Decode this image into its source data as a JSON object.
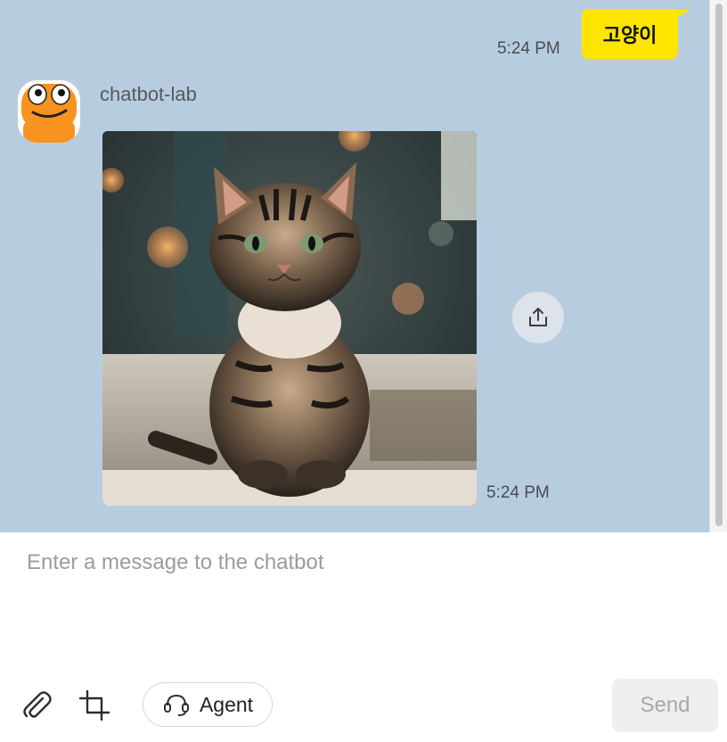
{
  "conversation": {
    "user_message": {
      "text": "고양이",
      "time": "5:24 PM",
      "bubble_color": "#fde500"
    },
    "bot_message": {
      "sender": "chatbot-lab",
      "time": "5:24 PM",
      "image": "photo of a tabby kitten sitting on a blanket with blurred bokeh lights",
      "share_icon": "share-icon"
    },
    "background_color": "#b8cce0"
  },
  "composer": {
    "placeholder": "Enter a message to the chatbot",
    "attach_icon": "paperclip-icon",
    "crop_icon": "crop-icon",
    "agent_label": "Agent",
    "agent_icon": "headset-icon",
    "send_label": "Send"
  }
}
